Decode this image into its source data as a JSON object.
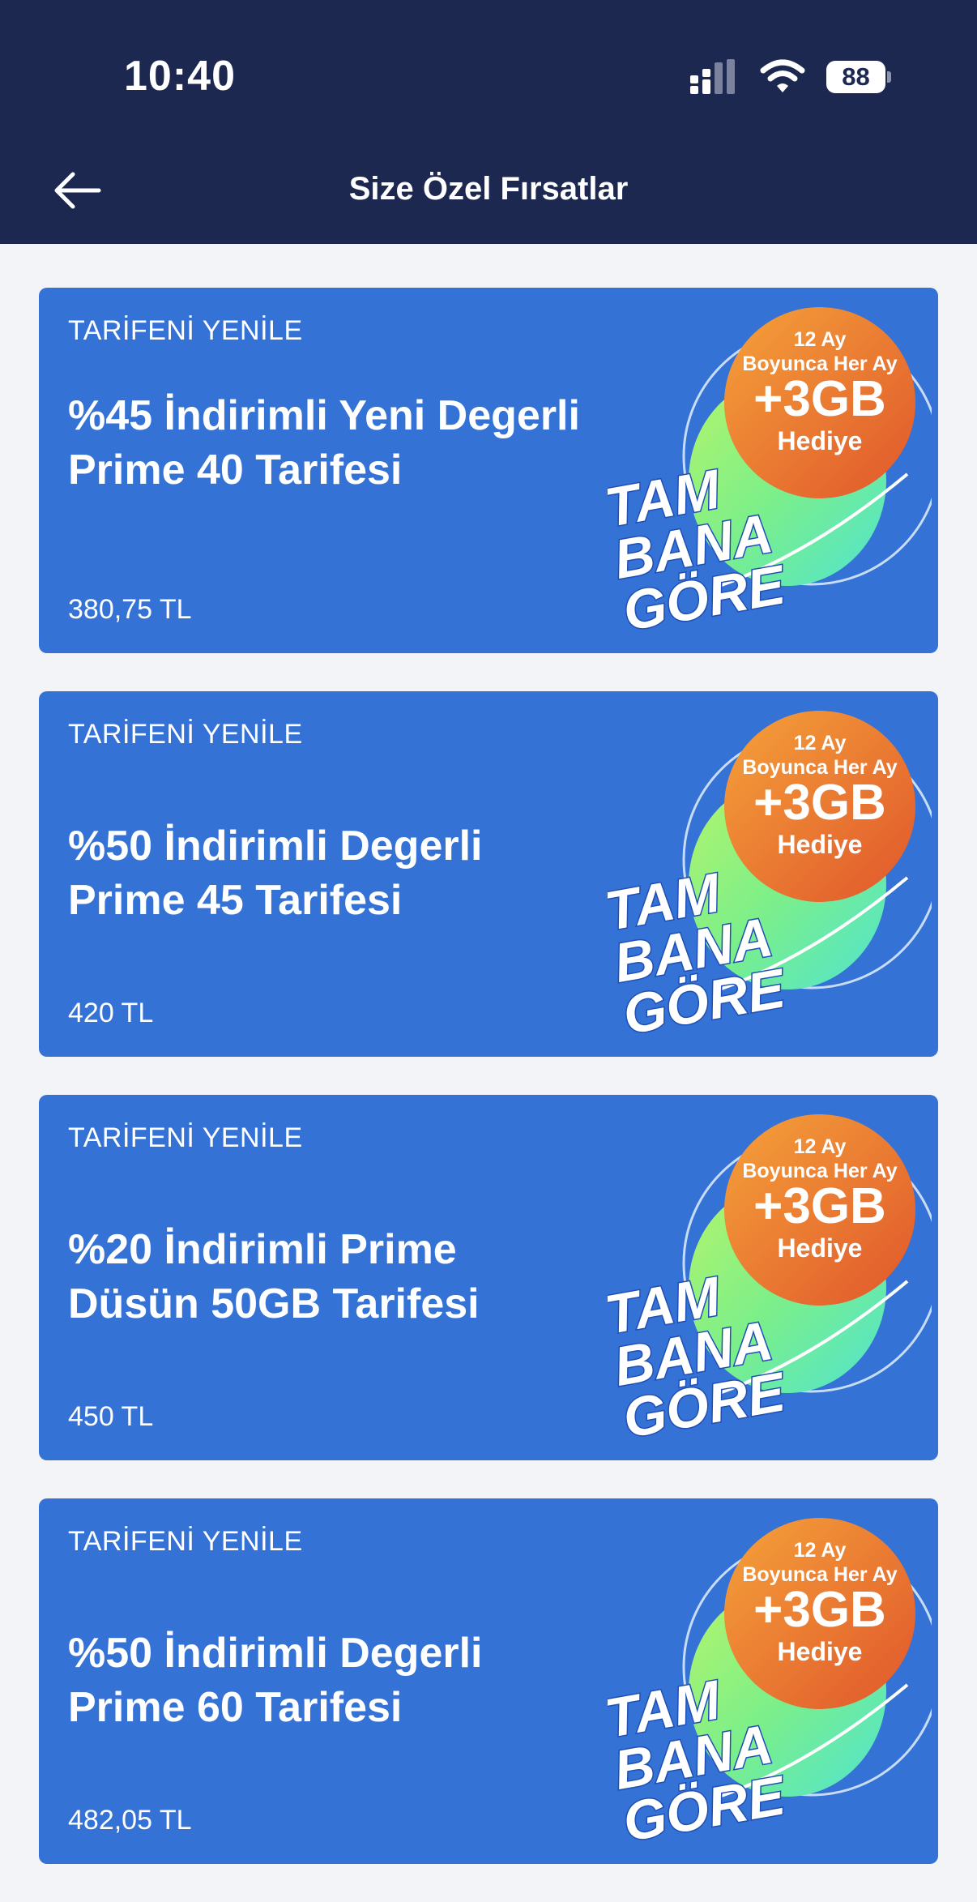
{
  "status_bar": {
    "time": "10:40",
    "battery": "88"
  },
  "header": {
    "title": "Size Özel Fırsatlar",
    "back_icon": "arrow-left-icon"
  },
  "colors": {
    "header_bg": "#1c2850",
    "card_bg": "#3472d6",
    "page_bg": "#f3f4f7",
    "badge_orange": "#e8732e",
    "badge_green": "#5ee6c0"
  },
  "badge": {
    "line1": "12 Ay",
    "line2": "Boyunca Her Ay",
    "line3": "+3GB",
    "line4": "Hediye",
    "word1": "TAM",
    "word2": "BANA",
    "word3": "GÖRE"
  },
  "offers": [
    {
      "tag": "TARİFENİ YENİLE",
      "title": "%45 İndirimli Yeni Degerli Prime 40 Tarifesi",
      "price": "380,75 TL"
    },
    {
      "tag": "TARİFENİ YENİLE",
      "title": "%50 İndirimli Degerli Prime 45 Tarifesi",
      "price": "420 TL"
    },
    {
      "tag": "TARİFENİ YENİLE",
      "title": "%20 İndirimli Prime Düsün 50GB Tarifesi",
      "price": "450 TL"
    },
    {
      "tag": "TARİFENİ YENİLE",
      "title": "%50 İndirimli Degerli Prime 60 Tarifesi",
      "price": "482,05 TL"
    }
  ]
}
